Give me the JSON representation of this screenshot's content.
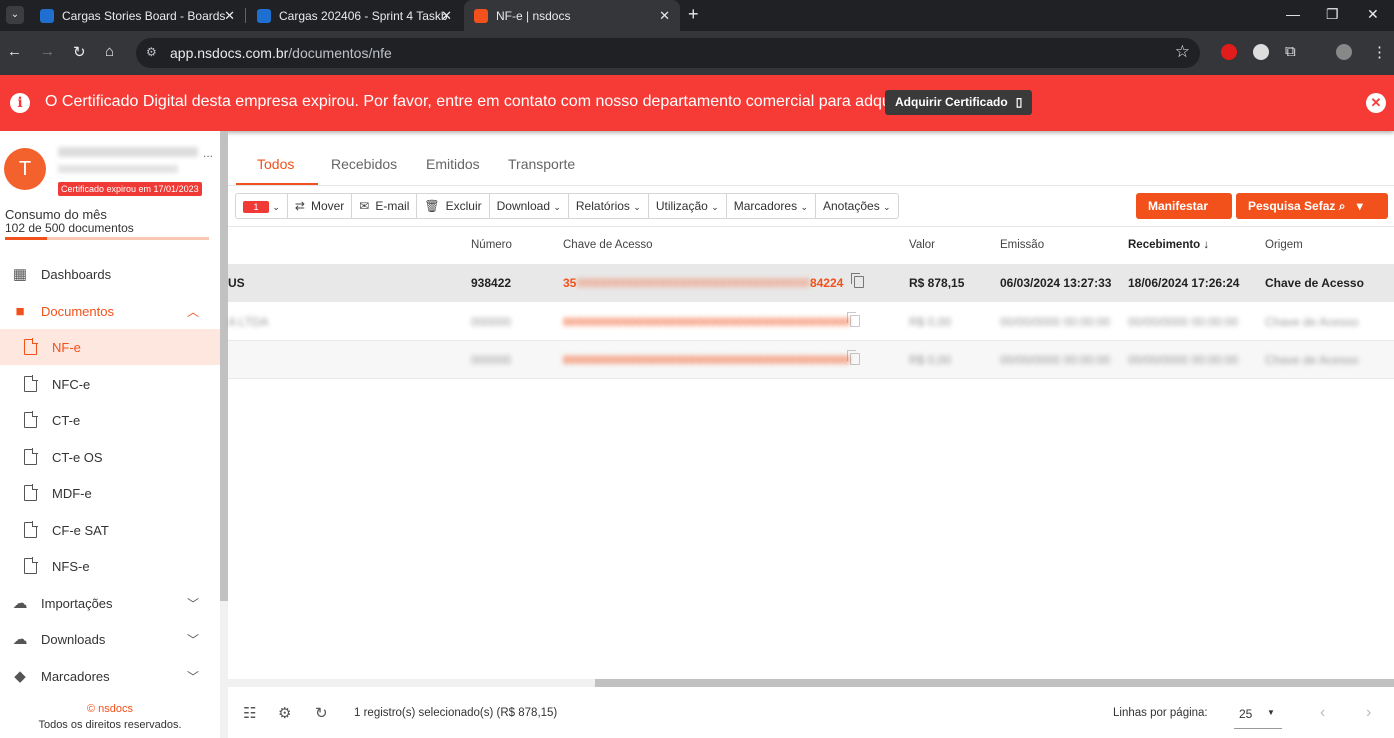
{
  "browser": {
    "tabs": [
      {
        "title": "Cargas Stories Board - Boards",
        "active": false
      },
      {
        "title": "Cargas 202406 - Sprint 4 Taskb",
        "active": false
      },
      {
        "title": "NF-e | nsdocs",
        "active": true
      }
    ],
    "url_domain": "app.nsdocs.com.br",
    "url_path": "/documentos/nfe"
  },
  "alert": {
    "message": "O Certificado Digital desta empresa expirou. Por favor, entre em contato com nosso departamento comercial para adquirir.",
    "button": "Adquirir Certificado"
  },
  "sidebar": {
    "avatar_letter": "T",
    "cert_badge": "Certificado expirou em 17/01/2023",
    "consumo_title": "Consumo do mês",
    "consumo_sub": "102 de 500 documentos",
    "consumo_fraction": 0.204,
    "nav": [
      {
        "label": "Dashboards",
        "icon": "dashboard-icon"
      },
      {
        "label": "Documentos",
        "icon": "folder-icon"
      },
      {
        "label": "Importações",
        "icon": "cloud-upload-icon"
      },
      {
        "label": "Downloads",
        "icon": "cloud-download-icon"
      },
      {
        "label": "Marcadores",
        "icon": "label-icon"
      }
    ],
    "docs": [
      "NF-e",
      "NFC-e",
      "CT-e",
      "CT-e OS",
      "MDF-e",
      "CF-e SAT",
      "NFS-e"
    ],
    "footer_brand": "© nsdocs",
    "footer_rights": "Todos os direitos reservados."
  },
  "tabs": [
    "Todos",
    "Recebidos",
    "Emitidos",
    "Transporte"
  ],
  "actions": {
    "selected_count": "1",
    "mover": "Mover",
    "email": "E-mail",
    "excluir": "Excluir",
    "download": "Download",
    "relatorios": "Relatórios",
    "utilizacao": "Utilização",
    "marcadores": "Marcadores",
    "anotacoes": "Anotações",
    "manifestar": "Manifestar",
    "pesquisa": "Pesquisa Sefaz"
  },
  "table": {
    "headers": [
      "Número",
      "Chave de Acesso",
      "Valor",
      "Emissão",
      "Recebimento",
      "Origem"
    ],
    "rows": [
      {
        "name": "US",
        "numero": "938422",
        "chave_start": "35",
        "chave_end": "84224",
        "valor": "R$ 878,15",
        "emissao": "06/03/2024 13:27:33",
        "recebimento": "18/06/2024 17:26:24",
        "origem": "Chave de Acesso"
      }
    ]
  },
  "bottom": {
    "selection_text": "1 registro(s) selecionado(s) (R$ 878,15)",
    "lines_label": "Linhas por página:",
    "lines_value": "25"
  }
}
